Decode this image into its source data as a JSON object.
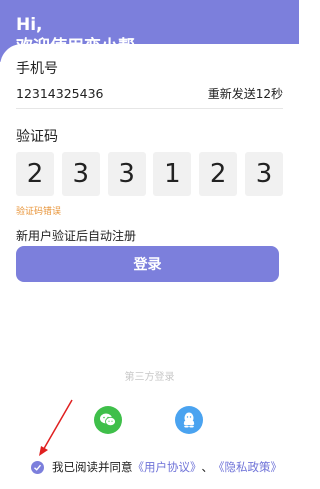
{
  "header": {
    "greeting": "Hi,",
    "welcome": "欢迎使用恋小帮"
  },
  "phone": {
    "label": "手机号",
    "value": "12314325436",
    "resend_label": "重新发送12秒"
  },
  "verify": {
    "label": "验证码",
    "digits": [
      "2",
      "3",
      "3",
      "1",
      "2",
      "3"
    ],
    "error_text": "验证码错误"
  },
  "auto_register_text": "新用户验证后自动注册",
  "login_button_label": "登录",
  "third_party": {
    "label": "第三方登录",
    "wechat_icon": "wechat-icon",
    "qq_icon": "qq-icon"
  },
  "agreement": {
    "checked": true,
    "prefix": "我已阅读并同意",
    "user_agreement": "《用户协议》",
    "separator": "、",
    "privacy_policy": "《隐私政策》"
  },
  "colors": {
    "accent": "#7c7fdc",
    "error": "#e89438",
    "wechat": "#3fbf4a",
    "qq": "#4aa3f0"
  }
}
